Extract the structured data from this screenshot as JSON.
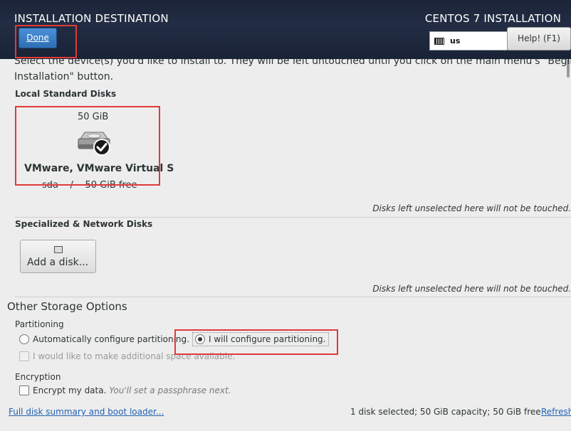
{
  "header": {
    "title": "INSTALLATION DESTINATION",
    "product": "CENTOS 7 INSTALLATION",
    "done_label": "Done",
    "keyboard_layout": "us",
    "help_label": "Help! (F1)"
  },
  "intro_line1": "Select the device(s) you'd like to install to. They will be left untouched until you click on the main menu's \"Begin",
  "intro_line2": "Installation\" button.",
  "local_disks": {
    "label": "Local Standard Disks",
    "disk": {
      "size": "50 GiB",
      "name": "VMware, VMware Virtual S",
      "device": "sda",
      "separator": "/",
      "free": "50 GiB free",
      "selected": true
    },
    "note": "Disks left unselected here will not be touched."
  },
  "specialized": {
    "label": "Specialized & Network Disks",
    "add_disk_label": "Add a disk...",
    "note": "Disks left unselected here will not be touched."
  },
  "other_storage": {
    "title": "Other Storage Options",
    "partitioning_label": "Partitioning",
    "auto_option": "Automatically configure partitioning.",
    "manual_option": "I will configure partitioning.",
    "selected_option": "manual",
    "additional_space": "I would like to make additional space available.",
    "encryption_label": "Encryption",
    "encrypt_option": "Encrypt my data.",
    "encrypt_hint": "You'll set a passphrase next."
  },
  "footer": {
    "summary_link": "Full disk summary and boot loader...",
    "status": "1 disk selected; 50 GiB capacity; 50 GiB free",
    "refresh_link": "Refresh..."
  },
  "colors": {
    "header_bg": "#1b2437",
    "done_button": "#3b80c6",
    "highlight_box": "#e03a3a",
    "link": "#2463b5"
  }
}
